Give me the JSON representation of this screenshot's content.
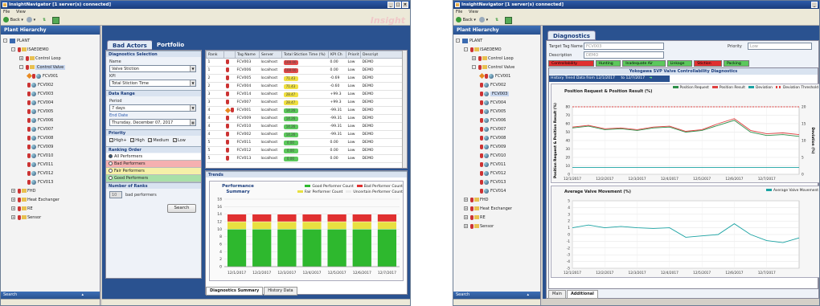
{
  "window1": {
    "title": "InsightNavigator [1 server(s) connected]",
    "menu": [
      "File",
      "View"
    ],
    "toolbar": {
      "back_label": "Back"
    },
    "watermark": "Insight",
    "sidebar": {
      "header": "Plant Hierarchy",
      "search_label": "Search",
      "tree": [
        {
          "label": "PLANT",
          "level": 0,
          "icon": "plant",
          "toggle": "-"
        },
        {
          "label": "ISAEDEMO",
          "level": 1,
          "icon": "folder",
          "toggle": "-"
        },
        {
          "label": "Control Loop",
          "level": 2,
          "icon": "folder",
          "toggle": "+"
        },
        {
          "label": "Control Valve",
          "level": 2,
          "icon": "folder",
          "toggle": "-",
          "selected": true
        },
        {
          "label": "FCV001",
          "level": 3,
          "icon": "valve",
          "pin": true
        },
        {
          "label": "FCV002",
          "level": 3,
          "icon": "valve"
        },
        {
          "label": "FCV003",
          "level": 3,
          "icon": "valve"
        },
        {
          "label": "FCV004",
          "level": 3,
          "icon": "valve"
        },
        {
          "label": "FCV005",
          "level": 3,
          "icon": "valve"
        },
        {
          "label": "FCV006",
          "level": 3,
          "icon": "valve"
        },
        {
          "label": "FCV007",
          "level": 3,
          "icon": "valve"
        },
        {
          "label": "FCV008",
          "level": 3,
          "icon": "valve"
        },
        {
          "label": "FCV009",
          "level": 3,
          "icon": "valve"
        },
        {
          "label": "FCV010",
          "level": 3,
          "icon": "valve"
        },
        {
          "label": "FCV011",
          "level": 3,
          "icon": "valve"
        },
        {
          "label": "FCV012",
          "level": 3,
          "icon": "valve"
        },
        {
          "label": "FCV013",
          "level": 3,
          "icon": "valve"
        },
        {
          "label": "FHD",
          "level": 1,
          "icon": "folder",
          "toggle": "+"
        },
        {
          "label": "Heat Exchanger",
          "level": 1,
          "icon": "folder",
          "toggle": "+"
        },
        {
          "label": "RE",
          "level": 1,
          "icon": "folder",
          "toggle": "+"
        },
        {
          "label": "Sensor",
          "level": 1,
          "icon": "folder",
          "toggle": "+"
        }
      ]
    },
    "tabs": [
      {
        "label": "Bad Actors",
        "active": true
      },
      {
        "label": "Portfolio",
        "active": false
      }
    ],
    "form": {
      "diag_section": "Diagnostics Selection",
      "name_label": "Name",
      "name_value": "Valve Stiction",
      "kpi_label": "KPI",
      "kpi_value": "Total Stiction Time",
      "range_section": "Data Range",
      "period_label": "Period",
      "period_value": "7 days",
      "end_label": "End Date",
      "end_value": "Thursday, December 07, 2017",
      "priority_section": "Priority",
      "priorities": [
        "High+",
        "High",
        "Medium",
        "Low"
      ],
      "ranking_section": "Ranking Order",
      "performers": [
        {
          "label": "All Performers",
          "selected": true,
          "color": "#ffffff"
        },
        {
          "label": "Bad Performers",
          "selected": false,
          "color": "#f5b0b0"
        },
        {
          "label": "Fair Performers",
          "selected": false,
          "color": "#f5f0a8"
        },
        {
          "label": "Good Performers",
          "selected": false,
          "color": "#a8e0a8"
        }
      ],
      "ranks_section": "Number of Ranks",
      "ranks_value": "10",
      "ranks_suffix": "bad performers",
      "search_button": "Search"
    },
    "table": {
      "columns": [
        "Rank",
        "",
        "Tag Name",
        "Server",
        "Total Stiction Time (%)",
        "KPI Ch",
        "Priorit",
        "Descript"
      ],
      "rows": [
        {
          "rank": "1",
          "tag": "FCV003",
          "server": "localhost",
          "value": "100.00",
          "color": "#e24a4a",
          "kpi": "0.00",
          "priority": "Low",
          "desc": "DEMO"
        },
        {
          "rank": "1",
          "tag": "FCV006",
          "server": "localhost",
          "value": "100.00",
          "color": "#e24a4a",
          "kpi": "0.00",
          "priority": "Low",
          "desc": "DEMO"
        },
        {
          "rank": "2",
          "tag": "FCV005",
          "server": "localhost",
          "value": "71.43",
          "color": "#f0e040",
          "kpi": "-0.69",
          "priority": "Low",
          "desc": "DEMO"
        },
        {
          "rank": "2",
          "tag": "FCV004",
          "server": "localhost",
          "value": "71.43",
          "color": "#f0e040",
          "kpi": "-0.60",
          "priority": "Low",
          "desc": "DEMO"
        },
        {
          "rank": "3",
          "tag": "FCV014",
          "server": "localhost",
          "value": "28.47",
          "color": "#f0e040",
          "kpi": "+99.3",
          "priority": "Low",
          "desc": "DEMO"
        },
        {
          "rank": "3",
          "tag": "FCV007",
          "server": "localhost",
          "value": "28.47",
          "color": "#f0e040",
          "kpi": "+99.3",
          "priority": "Low",
          "desc": "DEMO"
        },
        {
          "rank": "4",
          "tag": "FCV001",
          "server": "localhost",
          "value": "14.26",
          "color": "#5cc85c",
          "kpi": "-99.31",
          "priority": "Low",
          "desc": "DEMO",
          "pin": true
        },
        {
          "rank": "4",
          "tag": "FCV009",
          "server": "localhost",
          "value": "14.26",
          "color": "#5cc85c",
          "kpi": "-99.31",
          "priority": "Low",
          "desc": "DEMO"
        },
        {
          "rank": "4",
          "tag": "FCV010",
          "server": "localhost",
          "value": "14.26",
          "color": "#5cc85c",
          "kpi": "-99.31",
          "priority": "Low",
          "desc": "DEMO"
        },
        {
          "rank": "4",
          "tag": "FCV002",
          "server": "localhost",
          "value": "14.26",
          "color": "#5cc85c",
          "kpi": "-99.31",
          "priority": "Low",
          "desc": "DEMO"
        },
        {
          "rank": "5",
          "tag": "FCV011",
          "server": "localhost",
          "value": "0.00",
          "color": "#5cc85c",
          "kpi": "0.00",
          "priority": "Low",
          "desc": "DEMO"
        },
        {
          "rank": "5",
          "tag": "FCV012",
          "server": "localhost",
          "value": "0.00",
          "color": "#5cc85c",
          "kpi": "0.00",
          "priority": "Low",
          "desc": "DEMO"
        },
        {
          "rank": "5",
          "tag": "FCV013",
          "server": "localhost",
          "value": "0.00",
          "color": "#5cc85c",
          "kpi": "0.00",
          "priority": "Low",
          "desc": "DEMO"
        }
      ]
    },
    "trends": {
      "header": "Trends",
      "title": "Performance Summary",
      "legend": [
        {
          "label": "Good Performer Count",
          "color": "#2eb82e"
        },
        {
          "label": "Bad Performer Count",
          "color": "#e03030"
        },
        {
          "label": "Fair Performer Count",
          "color": "#e8e040"
        },
        {
          "label": "Uncertain Performer Count",
          "color": "#ececec"
        }
      ],
      "bottom_tabs": [
        "Diagnostics Summary",
        "History Data"
      ]
    }
  },
  "window2": {
    "title": "InsightNavigator [1 server(s) connected]",
    "menu": [
      "File",
      "View"
    ],
    "toolbar": {
      "back_label": "Back"
    },
    "sidebar": {
      "header": "Plant Hierarchy",
      "search_label": "Search",
      "tree": [
        {
          "label": "PLANT",
          "level": 0,
          "icon": "plant",
          "toggle": "-"
        },
        {
          "label": "ISAEDEMO",
          "level": 1,
          "icon": "folder",
          "toggle": "-"
        },
        {
          "label": "Control Loop",
          "level": 2,
          "icon": "folder",
          "toggle": "+"
        },
        {
          "label": "Control Valve",
          "level": 2,
          "icon": "folder",
          "toggle": "-"
        },
        {
          "label": "FCV001",
          "level": 3,
          "icon": "valve",
          "pin": true
        },
        {
          "label": "FCV002",
          "level": 3,
          "icon": "valve"
        },
        {
          "label": "FCV003",
          "level": 3,
          "icon": "valve",
          "selected": true
        },
        {
          "label": "FCV004",
          "level": 3,
          "icon": "valve"
        },
        {
          "label": "FCV005",
          "level": 3,
          "icon": "valve"
        },
        {
          "label": "FCV006",
          "level": 3,
          "icon": "valve"
        },
        {
          "label": "FCV007",
          "level": 3,
          "icon": "valve"
        },
        {
          "label": "FCV008",
          "level": 3,
          "icon": "valve"
        },
        {
          "label": "FCV009",
          "level": 3,
          "icon": "valve"
        },
        {
          "label": "FCV010",
          "level": 3,
          "icon": "valve"
        },
        {
          "label": "FCV011",
          "level": 3,
          "icon": "valve"
        },
        {
          "label": "FCV012",
          "level": 3,
          "icon": "valve"
        },
        {
          "label": "FCV013",
          "level": 3,
          "icon": "valve"
        },
        {
          "label": "FCV014",
          "level": 3,
          "icon": "valve"
        },
        {
          "label": "FHD",
          "level": 1,
          "icon": "folder",
          "toggle": "+"
        },
        {
          "label": "Heat Exchanger",
          "level": 1,
          "icon": "folder",
          "toggle": "+"
        },
        {
          "label": "RE",
          "level": 1,
          "icon": "folder",
          "toggle": "+"
        },
        {
          "label": "Sensor",
          "level": 1,
          "icon": "folder",
          "toggle": "+"
        }
      ]
    },
    "tab": "Diagnostics",
    "target_label": "Target Tag Name",
    "target_value": "FCV003",
    "priority_label": "Priority",
    "priority_value": "Low",
    "description_label": "Description",
    "description_value": "DEMO",
    "diag_tabs": [
      {
        "label": "Controllability",
        "color": "#e03030"
      },
      {
        "label": "Hunting",
        "color": "#5cc85c"
      },
      {
        "label": "Inadequate Air",
        "color": "#5cc85c"
      },
      {
        "label": "Linkage",
        "color": "#5cc85c"
      },
      {
        "label": "Stiction",
        "color": "#e03030"
      },
      {
        "label": "Packing",
        "color": "#5cc85c"
      }
    ],
    "diag_title": "Yokogawa SVP Valve Controllability Diagnostics",
    "history_label": "History Trend Data from 12/1/2017",
    "history_to": "to 12/7/2017",
    "bottom_tabs": [
      "Main",
      "Additional"
    ]
  },
  "chart_data": [
    {
      "type": "bar",
      "stacked": true,
      "categories": [
        "12/1/2017",
        "12/2/2017",
        "12/3/2017",
        "12/4/2017",
        "12/5/2017",
        "12/6/2017",
        "12/7/2017"
      ],
      "series": [
        {
          "name": "Good Performer Count",
          "color": "#2eb82e",
          "values": [
            10,
            10,
            10,
            10,
            10,
            10,
            10
          ]
        },
        {
          "name": "Fair Performer Count",
          "color": "#e8e040",
          "values": [
            2,
            2,
            2,
            2,
            2,
            2,
            2
          ]
        },
        {
          "name": "Bad Performer Count",
          "color": "#e03030",
          "values": [
            2,
            2,
            2,
            2,
            2,
            2,
            2
          ]
        },
        {
          "name": "Uncertain Performer Count",
          "color": "#ececec",
          "values": [
            0,
            0,
            0,
            0,
            0,
            0,
            0
          ]
        }
      ],
      "ylim": [
        0,
        18
      ],
      "yticks": [
        0,
        2,
        4,
        6,
        8,
        10,
        12,
        14,
        16,
        18
      ],
      "legend": "top-right"
    },
    {
      "type": "line",
      "title": "Position Request & Position Result (%)",
      "ylabel": "Position Request & Position Result (%)",
      "y2label": "Deviation (%)",
      "x": [
        "12/1/2017",
        "12/2/2017",
        "12/3/2017",
        "12/4/2017",
        "12/5/2017",
        "12/6/2017",
        "12/7/2017"
      ],
      "ylim": [
        0,
        80
      ],
      "yticks": [
        0,
        10,
        20,
        30,
        40,
        50,
        60,
        70,
        80
      ],
      "y2ticks": [
        0,
        5,
        10,
        15,
        20
      ],
      "series": [
        {
          "name": "Position Request",
          "color": "#2d8f4a",
          "values": [
            55,
            57,
            53,
            54,
            52,
            55,
            56,
            50,
            52,
            58,
            64,
            50,
            46,
            47,
            45
          ]
        },
        {
          "name": "Position Result",
          "color": "#e04040",
          "values": [
            56,
            58,
            54,
            55,
            53,
            56,
            57,
            51,
            53,
            60,
            66,
            52,
            48,
            49,
            47
          ]
        },
        {
          "name": "Deviation",
          "color": "#1aa3a3",
          "values": [
            2,
            2,
            2,
            2,
            2,
            2,
            2,
            2,
            2,
            2,
            2,
            2,
            2,
            2,
            2
          ]
        },
        {
          "name": "Deviation Threshold",
          "color": "#e04040",
          "dashed": true,
          "values": [
            20,
            20,
            20,
            20,
            20,
            20,
            20,
            20,
            20,
            20,
            20,
            20,
            20,
            20,
            20
          ]
        }
      ],
      "legend": "top-right"
    },
    {
      "type": "line",
      "title": "Average Valve Movement (%)",
      "x": [
        "12/1/2017",
        "12/2/2017",
        "12/3/2017",
        "12/4/2017",
        "12/5/2017",
        "12/6/2017",
        "12/7/2017"
      ],
      "ylim": [
        -5,
        5
      ],
      "yticks": [
        -5,
        -4,
        -3,
        -2,
        -1,
        0,
        1,
        2,
        3,
        4,
        5
      ],
      "series": [
        {
          "name": "Average Valve Movement",
          "color": "#1aa3a3",
          "values": [
            1.0,
            1.4,
            1.0,
            1.2,
            1.0,
            0.9,
            1.0,
            -0.4,
            -0.2,
            0.0,
            1.6,
            0.0,
            -0.9,
            -1.2,
            -0.5
          ]
        }
      ],
      "legend": "top-right"
    }
  ]
}
